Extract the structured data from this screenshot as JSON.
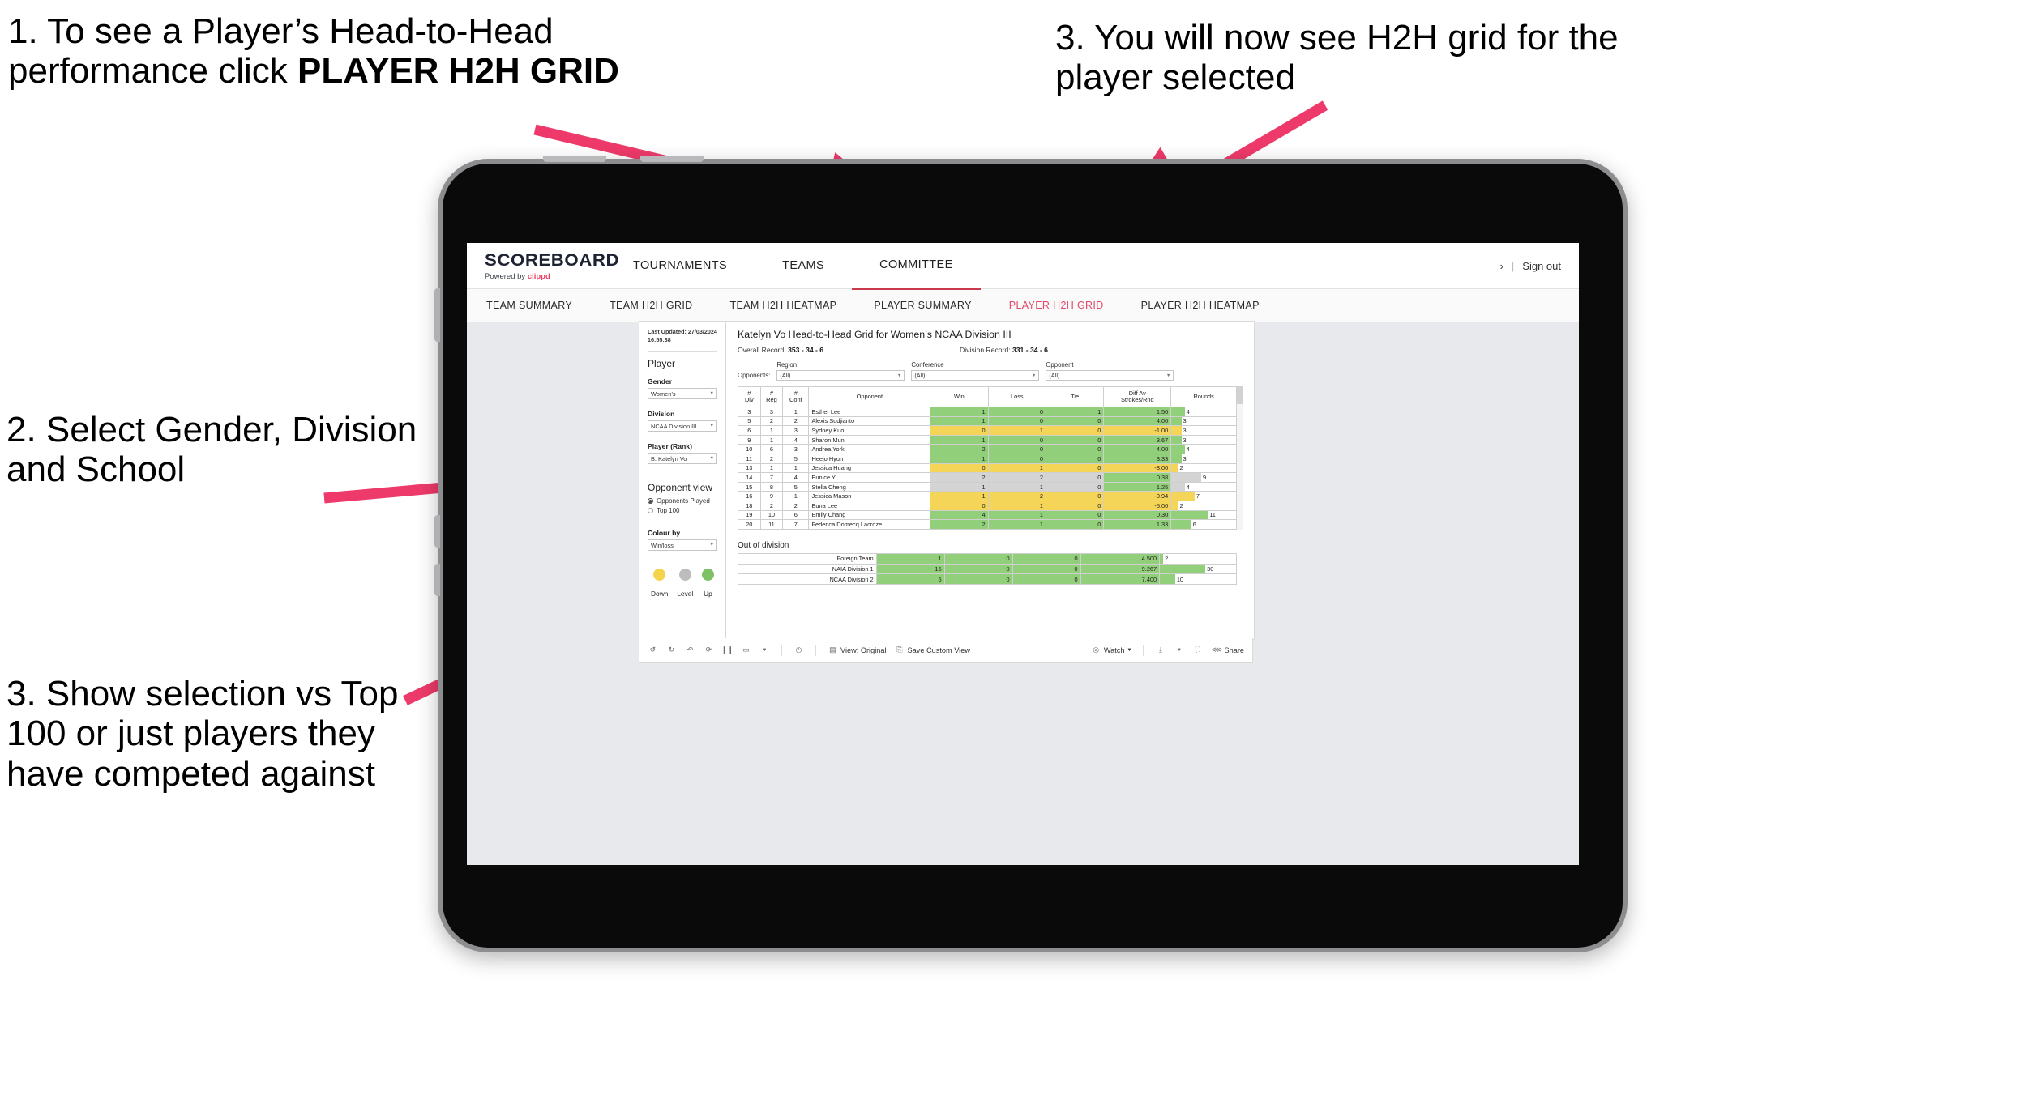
{
  "annotations": [
    {
      "id": "anno1",
      "text_plain": "1. To see a Player’s Head-to-Head performance click ",
      "text_bold": "PLAYER H2H GRID"
    },
    {
      "id": "anno2",
      "text": "2. Select Gender, Division and School"
    },
    {
      "id": "anno3",
      "text": "3. Show selection vs Top 100 or just players they have competed against"
    },
    {
      "id": "anno4",
      "text": "3. You will now see H2H grid for the player selected"
    }
  ],
  "app": {
    "brand": {
      "name": "SCOREBOARD",
      "powered_prefix": "Powered by ",
      "powered_brand": "clippd"
    },
    "top_nav": [
      {
        "label": "TOURNAMENTS",
        "active": false
      },
      {
        "label": "TEAMS",
        "active": false
      },
      {
        "label": "COMMITTEE",
        "active": true
      }
    ],
    "top_right": {
      "chevron": "›",
      "separator": "|",
      "sign_out": "Sign out"
    },
    "sub_nav": [
      {
        "label": "TEAM SUMMARY",
        "active": false
      },
      {
        "label": "TEAM H2H GRID",
        "active": false
      },
      {
        "label": "TEAM H2H HEATMAP",
        "active": false
      },
      {
        "label": "PLAYER SUMMARY",
        "active": false
      },
      {
        "label": "PLAYER H2H GRID",
        "active": true
      },
      {
        "label": "PLAYER H2H HEATMAP",
        "active": false
      }
    ]
  },
  "sidepanel": {
    "last_updated": "Last Updated: 27/03/2024 16:55:38",
    "section_title": "Player",
    "fields": [
      {
        "label": "Gender",
        "value": "Women’s"
      },
      {
        "label": "Division",
        "value": "NCAA Division III"
      },
      {
        "label": "Player (Rank)",
        "value": "B. Katelyn Vo"
      }
    ],
    "opponent_view": {
      "title": "Opponent view",
      "options": [
        {
          "label": "Opponents Played",
          "selected": true
        },
        {
          "label": "Top 100",
          "selected": false
        }
      ]
    },
    "colour_by": {
      "label": "Colour by",
      "value": "Win/loss"
    },
    "legend": [
      {
        "label": "Down",
        "color": "#f4d44d"
      },
      {
        "label": "Level",
        "color": "#bdbdbd"
      },
      {
        "label": "Up",
        "color": "#7cc163"
      }
    ]
  },
  "viz": {
    "title": "Katelyn Vo Head-to-Head Grid for Women’s NCAA Division III",
    "overall_record_label": "Overall Record: ",
    "overall_record_value": "353 - 34 - 6",
    "division_record_label": "Division Record: ",
    "division_record_value": "331 - 34 - 6",
    "opponents_label": "Opponents:",
    "filters": [
      {
        "label": "Region",
        "value": "(All)"
      },
      {
        "label": "Conference",
        "value": "(All)"
      },
      {
        "label": "Opponent",
        "value": "(All)"
      }
    ],
    "out_of_division_title": "Out of division"
  },
  "chart_data": {
    "type": "table",
    "title": "Katelyn Vo Head-to-Head Grid for Women’s NCAA Division III",
    "columns": [
      "# Div",
      "# Reg",
      "# Conf",
      "Opponent",
      "Win",
      "Loss",
      "Tie",
      "Diff Av Strokes/Rnd",
      "Rounds"
    ],
    "column_headers_two_line": [
      {
        "l1": "#",
        "l2": "Div"
      },
      {
        "l1": "#",
        "l2": "Reg"
      },
      {
        "l1": "#",
        "l2": "Conf"
      },
      {
        "l1": "Opponent",
        "l2": ""
      },
      {
        "l1": "Win",
        "l2": ""
      },
      {
        "l1": "Loss",
        "l2": ""
      },
      {
        "l1": "Tie",
        "l2": ""
      },
      {
        "l1": "Diff Av",
        "l2": "Strokes/Rnd"
      },
      {
        "l1": "Rounds",
        "l2": ""
      }
    ],
    "max_rounds": 30,
    "colors": {
      "up": "#92cf7a",
      "down": "#f5d558",
      "level": "#d4d4d4",
      "white": "#ffffff"
    },
    "rows": [
      {
        "div": "3",
        "reg": "3",
        "conf": "1",
        "opponent": "Esther Lee",
        "win": "1",
        "loss": "0",
        "tie": "1",
        "diff": "1.50",
        "rounds": 4,
        "state": "up"
      },
      {
        "div": "5",
        "reg": "2",
        "conf": "2",
        "opponent": "Alexis Sudjianto",
        "win": "1",
        "loss": "0",
        "tie": "0",
        "diff": "4.00",
        "rounds": 3,
        "state": "up"
      },
      {
        "div": "6",
        "reg": "1",
        "conf": "3",
        "opponent": "Sydney Kuo",
        "win": "0",
        "loss": "1",
        "tie": "0",
        "diff": "-1.00",
        "rounds": 3,
        "state": "down"
      },
      {
        "div": "9",
        "reg": "1",
        "conf": "4",
        "opponent": "Sharon Mun",
        "win": "1",
        "loss": "0",
        "tie": "0",
        "diff": "3.67",
        "rounds": 3,
        "state": "up"
      },
      {
        "div": "10",
        "reg": "6",
        "conf": "3",
        "opponent": "Andrea York",
        "win": "2",
        "loss": "0",
        "tie": "0",
        "diff": "4.00",
        "rounds": 4,
        "state": "up"
      },
      {
        "div": "11",
        "reg": "2",
        "conf": "5",
        "opponent": "Heejo Hyun",
        "win": "1",
        "loss": "0",
        "tie": "0",
        "diff": "3.33",
        "rounds": 3,
        "state": "up"
      },
      {
        "div": "13",
        "reg": "1",
        "conf": "1",
        "opponent": "Jessica Huang",
        "win": "0",
        "loss": "1",
        "tie": "0",
        "diff": "-3.00",
        "rounds": 2,
        "state": "down"
      },
      {
        "div": "14",
        "reg": "7",
        "conf": "4",
        "opponent": "Eunice Yi",
        "win": "2",
        "loss": "2",
        "tie": "0",
        "diff": "0.38",
        "rounds": 9,
        "state": "level",
        "diff_state": "up"
      },
      {
        "div": "15",
        "reg": "8",
        "conf": "5",
        "opponent": "Stella Cheng",
        "win": "1",
        "loss": "1",
        "tie": "0",
        "diff": "1.25",
        "rounds": 4,
        "state": "level",
        "diff_state": "up"
      },
      {
        "div": "16",
        "reg": "9",
        "conf": "1",
        "opponent": "Jessica Mason",
        "win": "1",
        "loss": "2",
        "tie": "0",
        "diff": "-0.94",
        "rounds": 7,
        "state": "down"
      },
      {
        "div": "18",
        "reg": "2",
        "conf": "2",
        "opponent": "Euna Lee",
        "win": "0",
        "loss": "1",
        "tie": "0",
        "diff": "-5.00",
        "rounds": 2,
        "state": "down"
      },
      {
        "div": "19",
        "reg": "10",
        "conf": "6",
        "opponent": "Emily Chang",
        "win": "4",
        "loss": "1",
        "tie": "0",
        "diff": "0.30",
        "rounds": 11,
        "state": "up"
      },
      {
        "div": "20",
        "reg": "11",
        "conf": "7",
        "opponent": "Federica Domecq Lacroze",
        "win": "2",
        "loss": "1",
        "tie": "0",
        "diff": "1.33",
        "rounds": 6,
        "state": "up"
      }
    ],
    "out_of_division": {
      "title": "Out of division",
      "rows": [
        {
          "label": "Foreign Team",
          "win": "1",
          "loss": "0",
          "tie": "0",
          "diff": "4.500",
          "rounds": 2,
          "state": "up"
        },
        {
          "label": "NAIA Division 1",
          "win": "15",
          "loss": "0",
          "tie": "0",
          "diff": "9.267",
          "rounds": 30,
          "state": "up"
        },
        {
          "label": "NCAA Division 2",
          "win": "5",
          "loss": "0",
          "tie": "0",
          "diff": "7.400",
          "rounds": 10,
          "state": "up"
        }
      ]
    }
  },
  "toolbar": {
    "view_label": "View: Original",
    "save_label": "Save Custom View",
    "watch_label": "Watch",
    "share_label": "Share"
  },
  "colors": {
    "accent_pink": "#ec3e62",
    "arrow_pink": "#ee3a6a",
    "nav_active": "#e4486b"
  }
}
